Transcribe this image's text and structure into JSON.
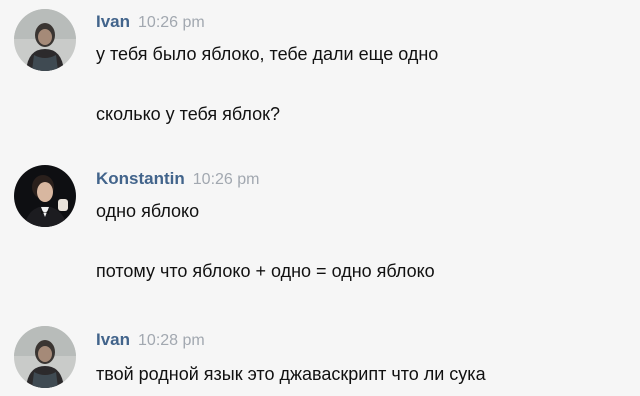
{
  "messages": [
    {
      "author": "Ivan",
      "time": "10:26 pm",
      "lines": [
        "у тебя было яблоко, тебе дали еще одно",
        "сколько у тебя яблок?"
      ]
    },
    {
      "author": "Konstantin",
      "time": "10:26 pm",
      "lines": [
        "одно яблоко",
        "потому что яблоко + одно = одно яблоко"
      ]
    },
    {
      "author": "Ivan",
      "time": "10:28 pm",
      "lines": [
        "твой родной язык это джаваскрипт что ли сука"
      ]
    }
  ],
  "colors": {
    "author": "#42648b",
    "time": "#a2a8b0",
    "text": "#111111",
    "background": "#f6f6f6"
  }
}
